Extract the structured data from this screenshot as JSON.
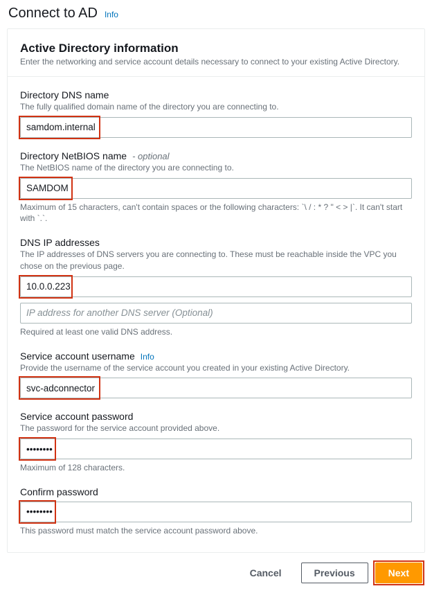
{
  "header": {
    "title": "Connect to AD",
    "info": "Info"
  },
  "section": {
    "title": "Active Directory information",
    "desc": "Enter the networking and service account details necessary to connect to your existing Active Directory."
  },
  "fields": {
    "dns_name": {
      "label": "Directory DNS name",
      "help": "The fully qualified domain name of the directory you are connecting to.",
      "value": "samdom.internal"
    },
    "netbios": {
      "label": "Directory NetBIOS name",
      "optional": "- optional",
      "help": "The NetBIOS name of the directory you are connecting to.",
      "value": "SAMDOM",
      "hint": "Maximum of 15 characters, can't contain spaces or the following characters: `\\ / : * ? \" < > |`. It can't start with `.`."
    },
    "dns_ips": {
      "label": "DNS IP addresses",
      "help": "The IP addresses of DNS servers you are connecting to. These must be reachable inside the VPC you chose on the previous page.",
      "value1": "10.0.0.223",
      "placeholder2": "IP address for another DNS server (Optional)",
      "hint": "Required at least one valid DNS address."
    },
    "svc_user": {
      "label": "Service account username",
      "info": "Info",
      "help": "Provide the username of the service account you created in your existing Active Directory.",
      "value": "svc-adconnector"
    },
    "svc_pass": {
      "label": "Service account password",
      "help": "The password for the service account provided above.",
      "value": "••••••••",
      "hint": "Maximum of 128 characters."
    },
    "confirm_pass": {
      "label": "Confirm password",
      "value": "••••••••",
      "hint": "This password must match the service account password above."
    }
  },
  "footer": {
    "cancel": "Cancel",
    "previous": "Previous",
    "next": "Next"
  }
}
